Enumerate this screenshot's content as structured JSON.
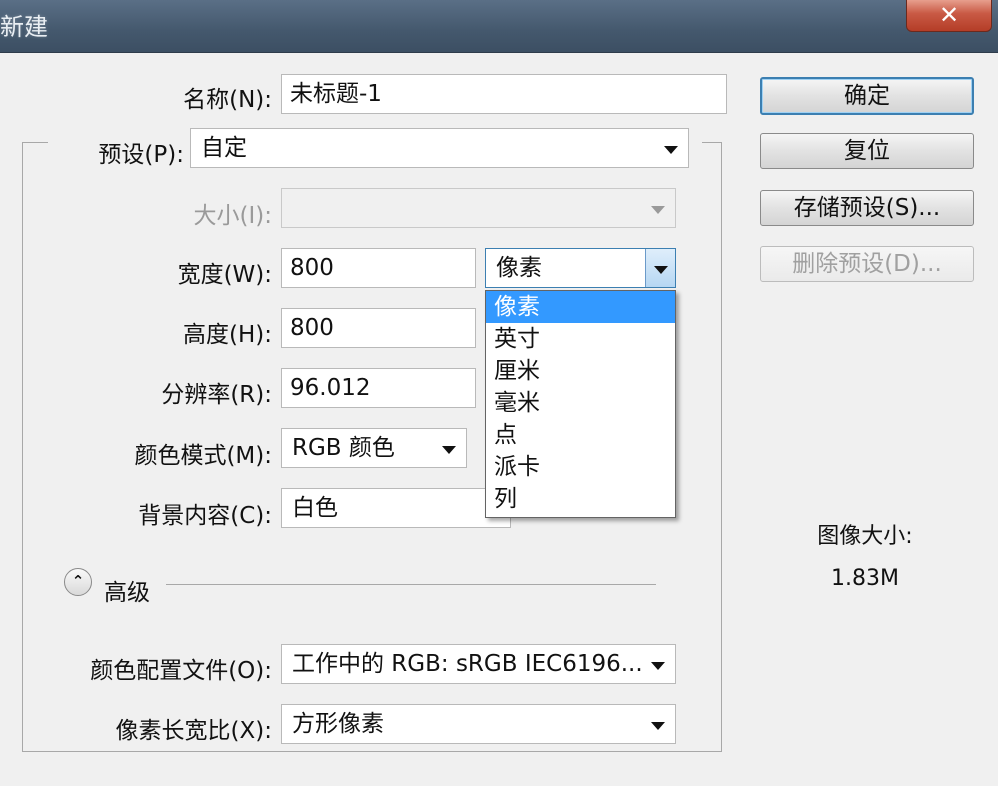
{
  "window": {
    "title": "新建",
    "close_icon": "✕"
  },
  "form": {
    "name": {
      "label": "名称(N):",
      "value": "未标题-1"
    },
    "preset": {
      "label": "预设(P):",
      "value": "自定"
    },
    "size": {
      "label": "大小(I):",
      "value": ""
    },
    "width": {
      "label": "宽度(W):",
      "value": "800",
      "unit": "像素"
    },
    "height": {
      "label": "高度(H):",
      "value": "800"
    },
    "resolution": {
      "label": "分辨率(R):",
      "value": "96.012"
    },
    "color_mode": {
      "label": "颜色模式(M):",
      "value": "RGB 颜色"
    },
    "background": {
      "label": "背景内容(C):",
      "value": "白色"
    },
    "advanced": {
      "label": "高级",
      "toggle_icon": "⌃"
    },
    "color_profile": {
      "label": "颜色配置文件(O):",
      "value": "工作中的 RGB: sRGB IEC6196..."
    },
    "pixel_aspect": {
      "label": "像素长宽比(X):",
      "value": "方形像素"
    }
  },
  "unit_dropdown": {
    "options": [
      "像素",
      "英寸",
      "厘米",
      "毫米",
      "点",
      "派卡",
      "列"
    ],
    "selected_index": 0
  },
  "buttons": {
    "ok": "确定",
    "reset": "复位",
    "save_preset": "存储预设(S)...",
    "delete_preset": "删除预设(D)..."
  },
  "image_size": {
    "label": "图像大小:",
    "value": "1.83M"
  }
}
